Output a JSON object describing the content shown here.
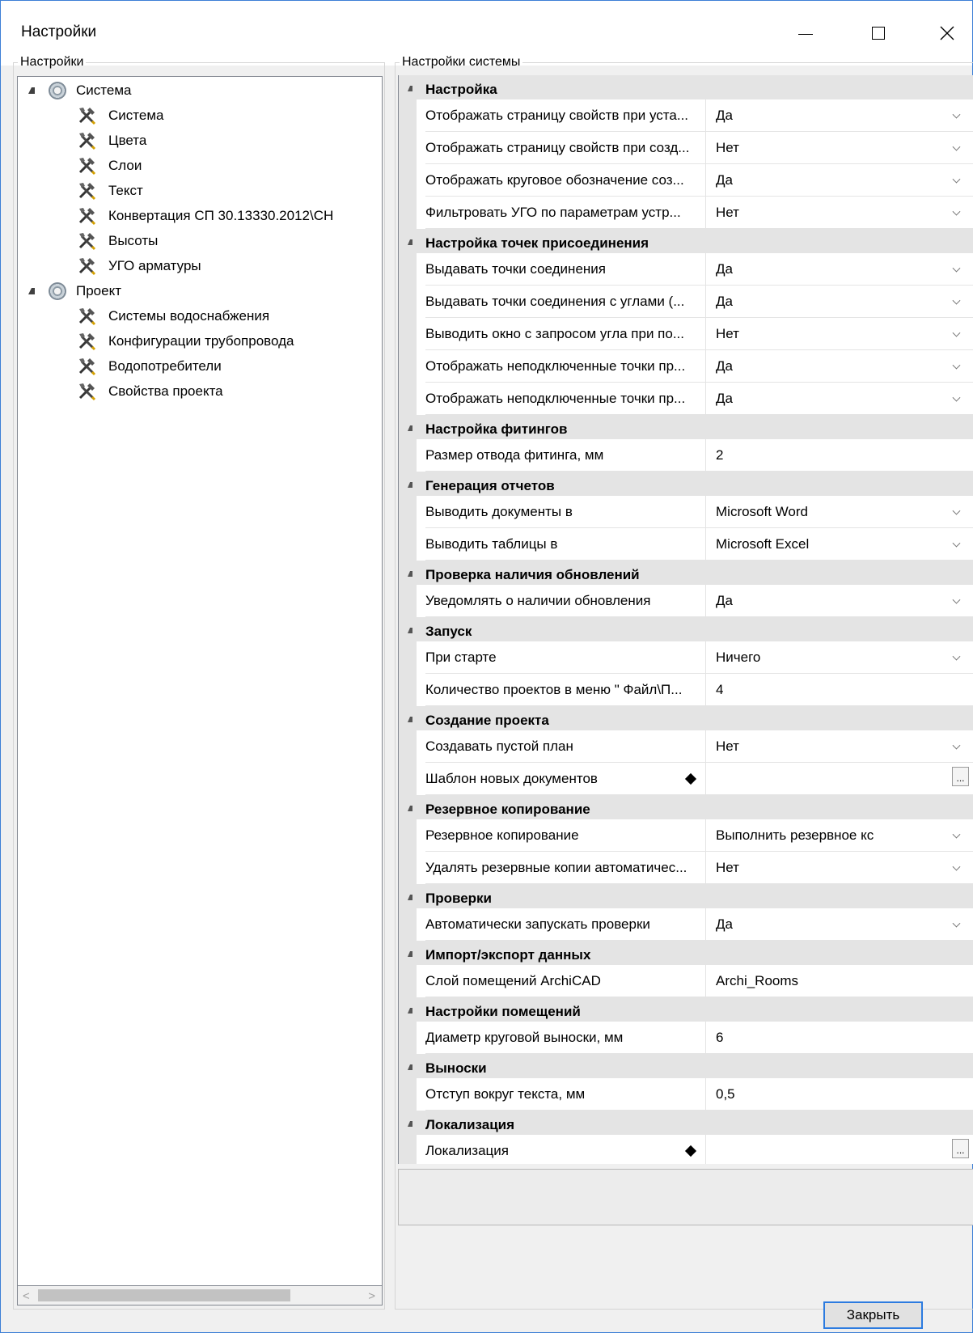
{
  "window": {
    "title": "Настройки"
  },
  "left_panel": {
    "legend": "Настройки",
    "tree": [
      {
        "label": "Система",
        "icon": "gear-icon",
        "expanded": true,
        "children": [
          "Система",
          "Цвета",
          "Слои",
          "Текст",
          "Конвертация СП 30.13330.2012\\СН",
          "Высоты",
          "УГО арматуры"
        ]
      },
      {
        "label": "Проект",
        "icon": "gear-icon",
        "expanded": true,
        "children": [
          "Системы водоснабжения",
          "Конфигурации трубопровода",
          "Водопотребители",
          "Свойства проекта"
        ]
      }
    ]
  },
  "right_panel": {
    "legend": "Настройки системы",
    "categories": [
      {
        "name": "Настройка",
        "props": [
          {
            "name": "Отображать страницу свойств при уста...",
            "value": "Да",
            "editor": "dropdown"
          },
          {
            "name": "Отображать страницу свойств при созд...",
            "value": "Нет",
            "editor": "dropdown"
          },
          {
            "name": "Отображать круговое обозначение соз...",
            "value": "Да",
            "editor": "dropdown"
          },
          {
            "name": "Фильтровать УГО по параметрам устр...",
            "value": "Нет",
            "editor": "dropdown"
          }
        ]
      },
      {
        "name": "Настройка точек присоединения",
        "props": [
          {
            "name": "Выдавать точки соединения",
            "value": "Да",
            "editor": "dropdown"
          },
          {
            "name": "Выдавать точки соединения с углами (...",
            "value": "Да",
            "editor": "dropdown"
          },
          {
            "name": "Выводить окно с запросом угла при по...",
            "value": "Нет",
            "editor": "dropdown"
          },
          {
            "name": "Отображать неподключенные точки пр...",
            "value": "Да",
            "editor": "dropdown"
          },
          {
            "name": "Отображать неподключенные точки пр...",
            "value": "Да",
            "editor": "dropdown"
          }
        ]
      },
      {
        "name": "Настройка фитингов",
        "props": [
          {
            "name": "Размер отвода фитинга, мм",
            "value": "2",
            "editor": "text"
          }
        ]
      },
      {
        "name": "Генерация отчетов",
        "props": [
          {
            "name": "Выводить документы в",
            "value": "Microsoft Word",
            "editor": "dropdown"
          },
          {
            "name": "Выводить таблицы в",
            "value": "Microsoft Excel",
            "editor": "dropdown"
          }
        ]
      },
      {
        "name": "Проверка наличия обновлений",
        "props": [
          {
            "name": "Уведомлять о наличии обновления",
            "value": "Да",
            "editor": "dropdown"
          }
        ]
      },
      {
        "name": "Запуск",
        "props": [
          {
            "name": "При старте",
            "value": "Ничего",
            "editor": "dropdown"
          },
          {
            "name": "Количество проектов в меню \" Файл\\П...",
            "value": "4",
            "editor": "text"
          }
        ]
      },
      {
        "name": "Создание проекта",
        "props": [
          {
            "name": "Создавать пустой план",
            "value": "Нет",
            "editor": "dropdown"
          },
          {
            "name": "Шаблон новых документов",
            "value": "",
            "editor": "ellipsis",
            "marker": true
          }
        ]
      },
      {
        "name": "Резервное копирование",
        "props": [
          {
            "name": "Резервное копирование",
            "value": "Выполнить резервное кс",
            "editor": "dropdown"
          },
          {
            "name": "Удалять резервные копии автоматичес...",
            "value": "Нет",
            "editor": "dropdown"
          }
        ]
      },
      {
        "name": "Проверки",
        "props": [
          {
            "name": "Автоматически запускать проверки",
            "value": "Да",
            "editor": "dropdown"
          }
        ]
      },
      {
        "name": "Импорт/экспорт данных",
        "props": [
          {
            "name": "Слой помещений ArchiCAD",
            "value": "Archi_Rooms",
            "editor": "text"
          }
        ]
      },
      {
        "name": "Настройки помещений",
        "props": [
          {
            "name": "Диаметр круговой выноски, мм",
            "value": "6",
            "editor": "text"
          }
        ]
      },
      {
        "name": "Выноски",
        "props": [
          {
            "name": "Отступ вокруг текста, мм",
            "value": "0,5",
            "editor": "text"
          }
        ]
      },
      {
        "name": "Локализация",
        "props": [
          {
            "name": "Локализация",
            "value": "",
            "editor": "ellipsis",
            "marker": true
          }
        ]
      }
    ]
  },
  "buttons": {
    "close": "Закрыть",
    "ellipsis": "..."
  }
}
